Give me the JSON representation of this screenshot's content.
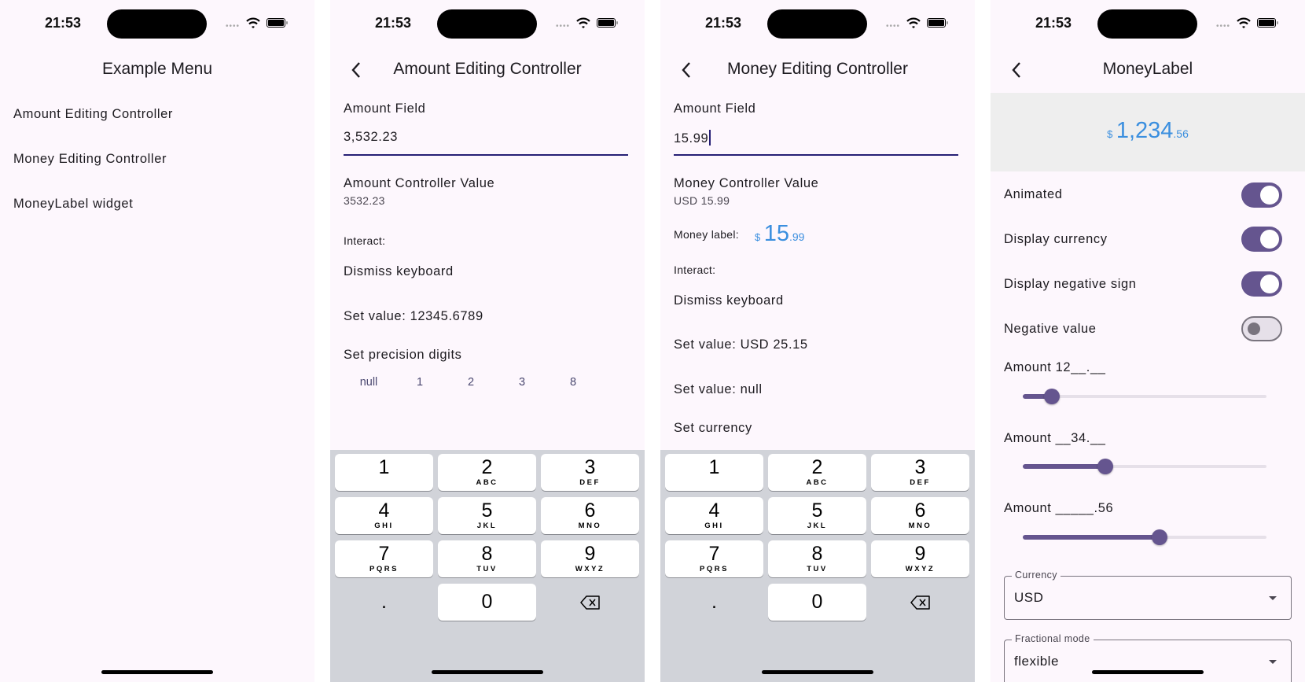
{
  "status_bar": {
    "time": "21:53"
  },
  "colors": {
    "accent": "#65558f",
    "money_blue": "#3b8fdf",
    "field_underline": "#262075",
    "keyboard_bg": "#d1d3d9",
    "surface": "#fdf7fd"
  },
  "keyboard": {
    "keys": [
      {
        "n": "1",
        "l": ""
      },
      {
        "n": "2",
        "l": "ABC"
      },
      {
        "n": "3",
        "l": "DEF"
      },
      {
        "n": "4",
        "l": "GHI"
      },
      {
        "n": "5",
        "l": "JKL"
      },
      {
        "n": "6",
        "l": "MNO"
      },
      {
        "n": "7",
        "l": "PQRS"
      },
      {
        "n": "8",
        "l": "TUV"
      },
      {
        "n": "9",
        "l": "WXYZ"
      }
    ],
    "dot": ".",
    "zero": "0"
  },
  "menu": {
    "title": "Example Menu",
    "items": [
      "Amount Editing Controller",
      "Money Editing Controller",
      "MoneyLabel widget"
    ]
  },
  "amount_screen": {
    "title": "Amount Editing Controller",
    "field_label": "Amount Field",
    "field_value": "3,532.23",
    "value_label": "Amount Controller Value",
    "value": "3532.23",
    "interact_label": "Interact:",
    "dismiss": "Dismiss keyboard",
    "set_value": "Set value: 12345.6789",
    "precision_label": "Set precision digits",
    "precision_options": [
      "null",
      "1",
      "2",
      "3",
      "8"
    ]
  },
  "money_screen": {
    "title": "Money Editing Controller",
    "field_label": "Amount Field",
    "field_value": "15.99",
    "value_label": "Money Controller Value",
    "value": "USD 15.99",
    "money_label_caption": "Money label:",
    "money_label": {
      "symbol": "$",
      "integer": "15",
      "fraction": ".99"
    },
    "interact_label": "Interact:",
    "dismiss": "Dismiss keyboard",
    "set_value": "Set value: USD 25.15",
    "set_null": "Set value: null",
    "set_currency": "Set currency"
  },
  "moneylabel_screen": {
    "title": "MoneyLabel",
    "preview": {
      "symbol": "$",
      "integer": "1,234",
      "fraction": ".56"
    },
    "toggles": [
      {
        "label": "Animated",
        "on": true
      },
      {
        "label": "Display currency",
        "on": true
      },
      {
        "label": "Display negative sign",
        "on": true
      },
      {
        "label": "Negative value",
        "on": false
      }
    ],
    "sliders": [
      {
        "label": "Amount 12__.__",
        "value": 0.12
      },
      {
        "label": "Amount __34.__",
        "value": 0.34
      },
      {
        "label": "Amount _____.56",
        "value": 0.56
      }
    ],
    "currency": {
      "label": "Currency",
      "value": "USD"
    },
    "fractional_mode": {
      "label": "Fractional mode",
      "value": "flexible"
    }
  }
}
